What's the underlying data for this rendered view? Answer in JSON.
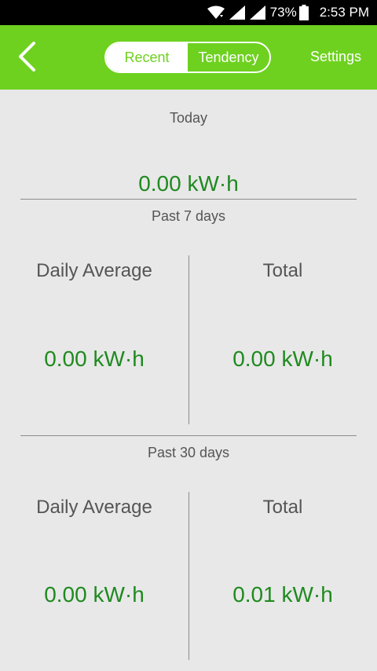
{
  "status_bar": {
    "battery_percent": "73%",
    "time": "2:53 PM",
    "icons": [
      "wifi-icon",
      "signal-icon",
      "signal-icon",
      "battery-icon"
    ]
  },
  "header": {
    "back_icon": "chevron-left-icon",
    "tabs": [
      {
        "label": "Recent",
        "active": true
      },
      {
        "label": "Tendency",
        "active": false
      }
    ],
    "settings_label": "Settings"
  },
  "today": {
    "label": "Today",
    "value": "0.00 kW·h"
  },
  "past_7_days": {
    "label": "Past 7 days",
    "daily_average_label": "Daily Average",
    "daily_average_value": "0.00 kW·h",
    "total_label": "Total",
    "total_value": "0.00 kW·h"
  },
  "past_30_days": {
    "label": "Past 30 days",
    "daily_average_label": "Daily Average",
    "daily_average_value": "0.00 kW·h",
    "total_label": "Total",
    "total_value": "0.01 kW·h"
  },
  "colors": {
    "brand_green": "#6ed11f",
    "value_green": "#1f8a1f",
    "background": "#e8e8e8"
  }
}
